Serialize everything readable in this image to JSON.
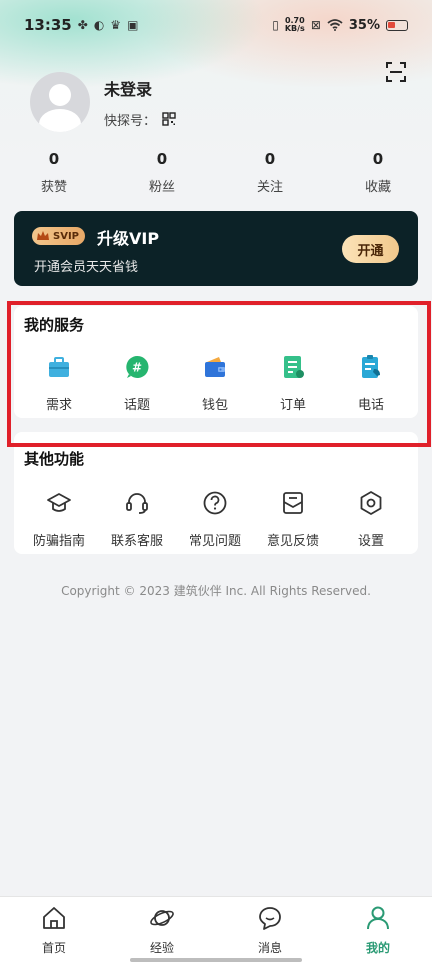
{
  "status_bar": {
    "time": "13:35",
    "network_speed_value": "0.70",
    "network_speed_unit": "KB/s",
    "battery": "35%"
  },
  "profile": {
    "username": "未登录",
    "kuaitan_label": "快探号："
  },
  "stats": [
    {
      "value": "0",
      "label": "获赞"
    },
    {
      "value": "0",
      "label": "粉丝"
    },
    {
      "value": "0",
      "label": "关注"
    },
    {
      "value": "0",
      "label": "收藏"
    }
  ],
  "vip": {
    "badge": "SVIP",
    "title": "升级VIP",
    "subtitle": "开通会员天天省钱",
    "button_label": "开通"
  },
  "my_services": {
    "title": "我的服务",
    "items": [
      {
        "label": "需求",
        "icon": "briefcase-icon"
      },
      {
        "label": "话题",
        "icon": "hashtag-icon"
      },
      {
        "label": "钱包",
        "icon": "wallet-icon"
      },
      {
        "label": "订单",
        "icon": "order-icon"
      },
      {
        "label": "电话",
        "icon": "phone-icon"
      }
    ]
  },
  "other_functions": {
    "title": "其他功能",
    "items": [
      {
        "label": "防骗指南",
        "icon": "graduation-cap-icon"
      },
      {
        "label": "联系客服",
        "icon": "headset-icon"
      },
      {
        "label": "常见问题",
        "icon": "question-icon"
      },
      {
        "label": "意见反馈",
        "icon": "feedback-icon"
      },
      {
        "label": "设置",
        "icon": "gear-icon"
      }
    ]
  },
  "copyright": "Copyright © 2023 建筑伙伴 Inc. All Rights Reserved.",
  "tabbar": [
    {
      "label": "首页",
      "icon": "home-icon"
    },
    {
      "label": "经验",
      "icon": "planet-icon"
    },
    {
      "label": "消息",
      "icon": "chat-icon"
    },
    {
      "label": "我的",
      "icon": "user-icon",
      "active": true
    }
  ],
  "colors": {
    "accent": "#2a9a74",
    "vip_bg": "#0c2227",
    "highlight": "#e0202a"
  }
}
